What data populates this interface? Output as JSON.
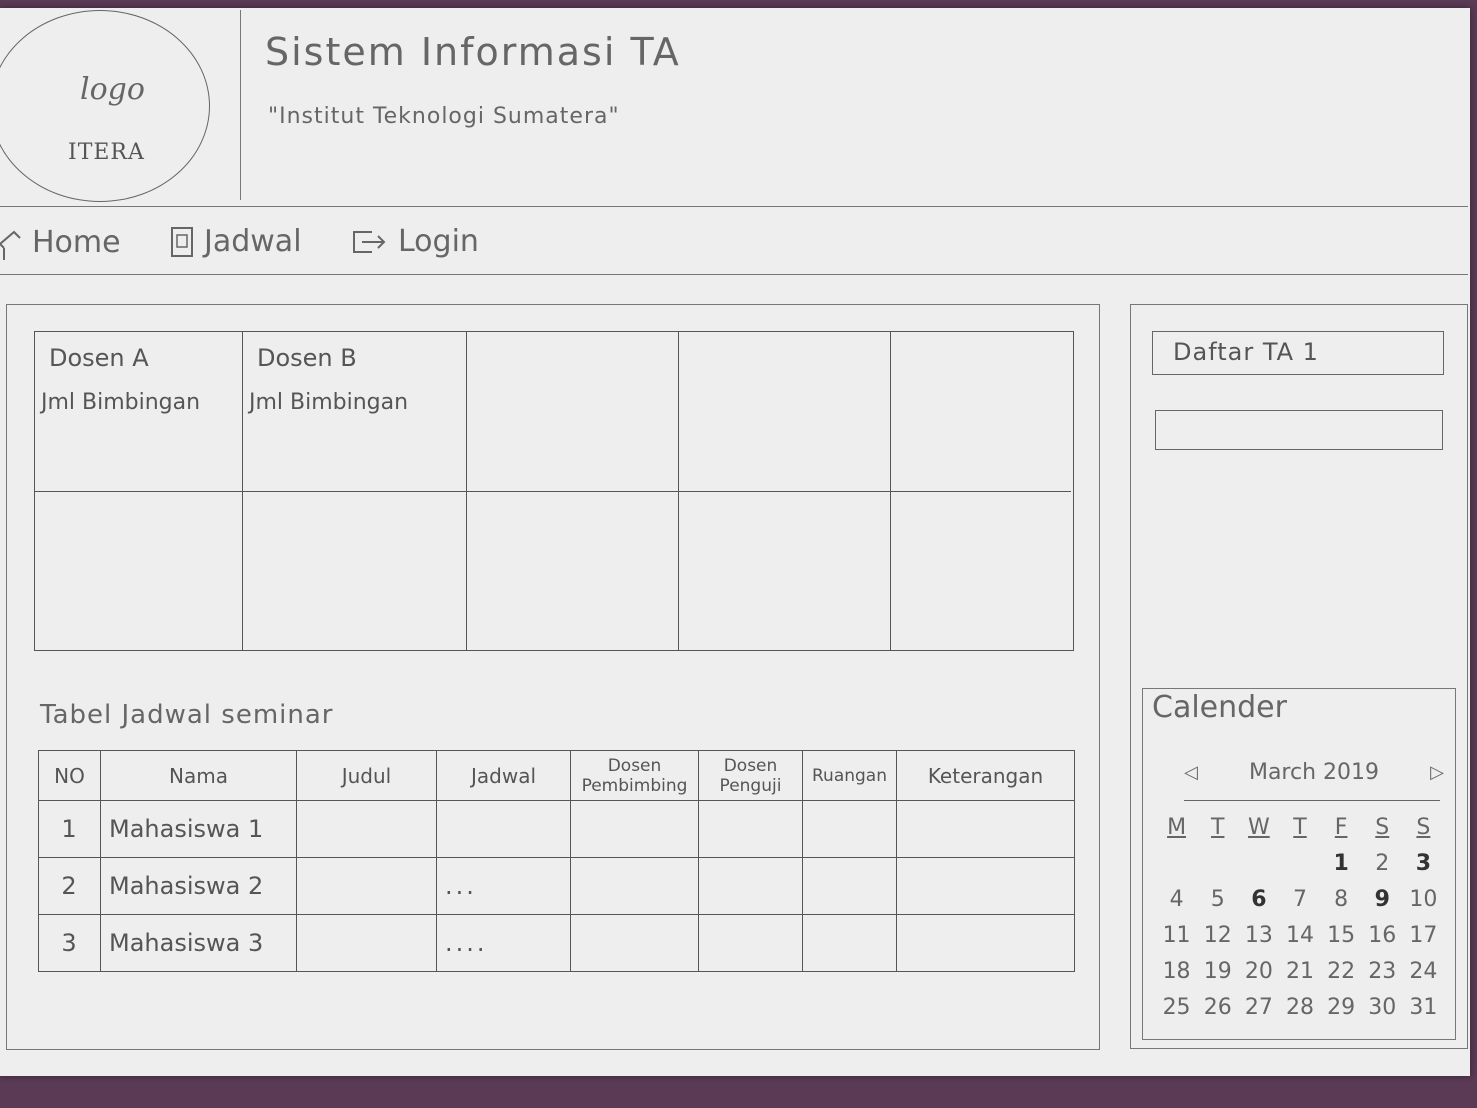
{
  "header": {
    "logo_text": "logo",
    "logo_sub": "ITERA",
    "title": "Sistem Informasi TA",
    "subtitle": "\"Institut Teknologi Sumatera\""
  },
  "nav": {
    "home": "Home",
    "jadwal": "Jadwal",
    "login": "Login"
  },
  "dosen": [
    {
      "name": "Dosen A",
      "count": "Jml Bimbingan"
    },
    {
      "name": "Dosen B",
      "count": "Jml Bimbingan"
    }
  ],
  "schedule": {
    "title": "Tabel Jadwal seminar",
    "headers": [
      "NO",
      "Nama",
      "Judul",
      "Jadwal",
      "Dosen Pembimbing",
      "Dosen Penguji",
      "Ruangan",
      "Keterangan"
    ],
    "rows": [
      {
        "no": "1",
        "nama": "Mahasiswa 1",
        "jadwal": ""
      },
      {
        "no": "2",
        "nama": "Mahasiswa 2",
        "jadwal": "..."
      },
      {
        "no": "3",
        "nama": "Mahasiswa 3",
        "jadwal": "...."
      }
    ]
  },
  "side": {
    "daftar": "Daftar TA 1"
  },
  "calendar": {
    "title": "Calender",
    "month": "March 2019",
    "weekdays": [
      "M",
      "T",
      "W",
      "T",
      "F",
      "S",
      "S"
    ],
    "days": [
      "1",
      "2",
      "3",
      "4",
      "5",
      "6",
      "7",
      "8",
      "9",
      "10",
      "11",
      "12",
      "13",
      "14",
      "15",
      "16",
      "17",
      "18",
      "19",
      "20",
      "21",
      "22",
      "23",
      "24",
      "25",
      "26",
      "27",
      "28",
      "29",
      "30",
      "31"
    ],
    "first_weekday_index": 4,
    "bold_days": [
      "1",
      "3",
      "6",
      "9"
    ]
  }
}
